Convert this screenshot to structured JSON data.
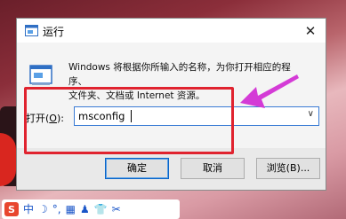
{
  "dialog": {
    "title": "运行",
    "close_glyph": "✕",
    "description_line1": "Windows 将根据你所输入的名称，为你打开相应的程序、",
    "description_line2": "文件夹、文档或 Internet 资源。",
    "open_label": "打开(",
    "open_accel": "O",
    "open_label_end": "):",
    "command_value": "msconfig",
    "dropdown_glyph": "∨",
    "buttons": {
      "ok": "确定",
      "cancel": "取消",
      "browse": "浏览(B)..."
    }
  },
  "taskbar": {
    "ime_logo": "S",
    "items": [
      "中",
      "☽",
      "°,",
      "▦",
      "♟",
      "👕",
      "✂"
    ]
  },
  "colors": {
    "highlight_box": "#e0232f",
    "arrow": "#d43bd6",
    "accent": "#0a64c8"
  }
}
